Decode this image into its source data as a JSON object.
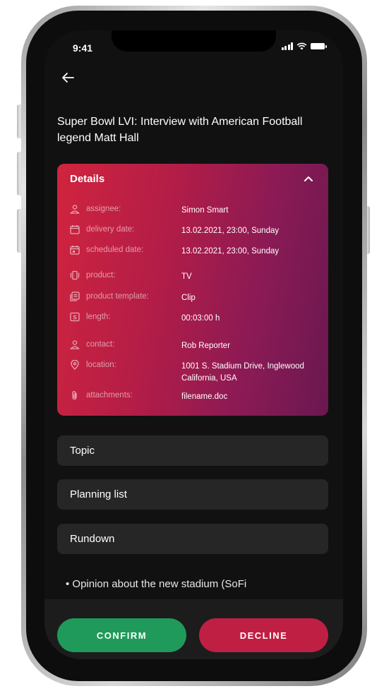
{
  "status_bar": {
    "time": "9:41"
  },
  "header": {
    "title": "Super Bowl LVI: Interview with American Football legend Matt Hall"
  },
  "details": {
    "heading": "Details",
    "rows": [
      {
        "label": "assignee:",
        "value": "Simon Smart",
        "icon": "user-icon"
      },
      {
        "label": "delivery date:",
        "value": "13.02.2021, 23:00, Sunday",
        "icon": "calendar-icon"
      },
      {
        "label": "scheduled date:",
        "value": "13.02.2021, 23:00, Sunday",
        "icon": "calendar-event-icon"
      },
      {
        "label": "product:",
        "value": "TV",
        "icon": "product-icon"
      },
      {
        "label": "product template:",
        "value": "Clip",
        "icon": "template-icon"
      },
      {
        "label": "length:",
        "value": "00:03:00 h",
        "icon": "length-icon"
      },
      {
        "label": "contact:",
        "value": "Rob Reporter",
        "icon": "user-icon"
      },
      {
        "label": "location:",
        "value": "1001 S. Stadium Drive, Inglewood California, USA",
        "icon": "location-pin-icon"
      },
      {
        "label": "attachments:",
        "value": "filename.doc",
        "icon": "paperclip-icon"
      }
    ]
  },
  "sections": [
    {
      "label": "Topic"
    },
    {
      "label": "Planning list"
    },
    {
      "label": "Rundown"
    }
  ],
  "content": {
    "bullet": "• Opinion about the new stadium (SoFi"
  },
  "actions": {
    "confirm": "CONFIRM",
    "decline": "DECLINE"
  },
  "colors": {
    "card_gradient_start": "#d0243e",
    "card_gradient_end": "#6a1850",
    "confirm": "#1f9a5a",
    "decline": "#c01f44",
    "background": "#111111"
  }
}
